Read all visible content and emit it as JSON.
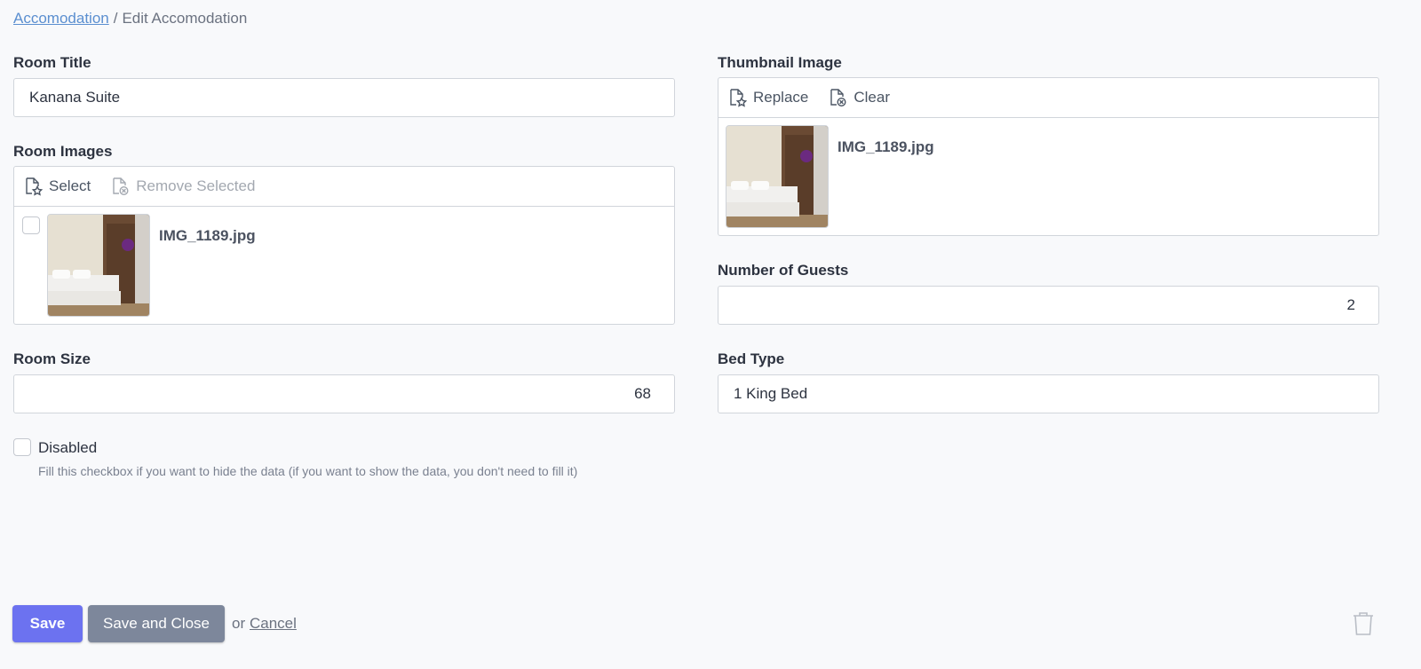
{
  "breadcrumb": {
    "parent": "Accomodation",
    "separator": "/",
    "current": "Edit Accomodation"
  },
  "fields": {
    "room_title": {
      "label": "Room Title",
      "value": "Kanana Suite"
    },
    "room_images": {
      "label": "Room Images",
      "select_label": "Select",
      "remove_label": "Remove Selected",
      "files": [
        {
          "name": "IMG_1189.jpg"
        }
      ]
    },
    "thumbnail": {
      "label": "Thumbnail Image",
      "replace_label": "Replace",
      "clear_label": "Clear",
      "file": "IMG_1189.jpg"
    },
    "guests": {
      "label": "Number of Guests",
      "value": "2"
    },
    "room_size": {
      "label": "Room Size",
      "value": "68"
    },
    "bed_type": {
      "label": "Bed Type",
      "value": "1 King Bed"
    },
    "disabled": {
      "label": "Disabled",
      "hint": "Fill this checkbox if you want to hide the data (if you want to show the data, you don't need to fill it)"
    }
  },
  "actions": {
    "save": "Save",
    "save_close": "Save and Close",
    "or": "or",
    "cancel": "Cancel"
  },
  "colors": {
    "primary": "#6c72f0",
    "secondary": "#7d879b",
    "link": "#5b8fd0"
  },
  "icons": {
    "select": "file-star-icon",
    "remove": "file-x-icon",
    "delete": "trash-icon"
  }
}
